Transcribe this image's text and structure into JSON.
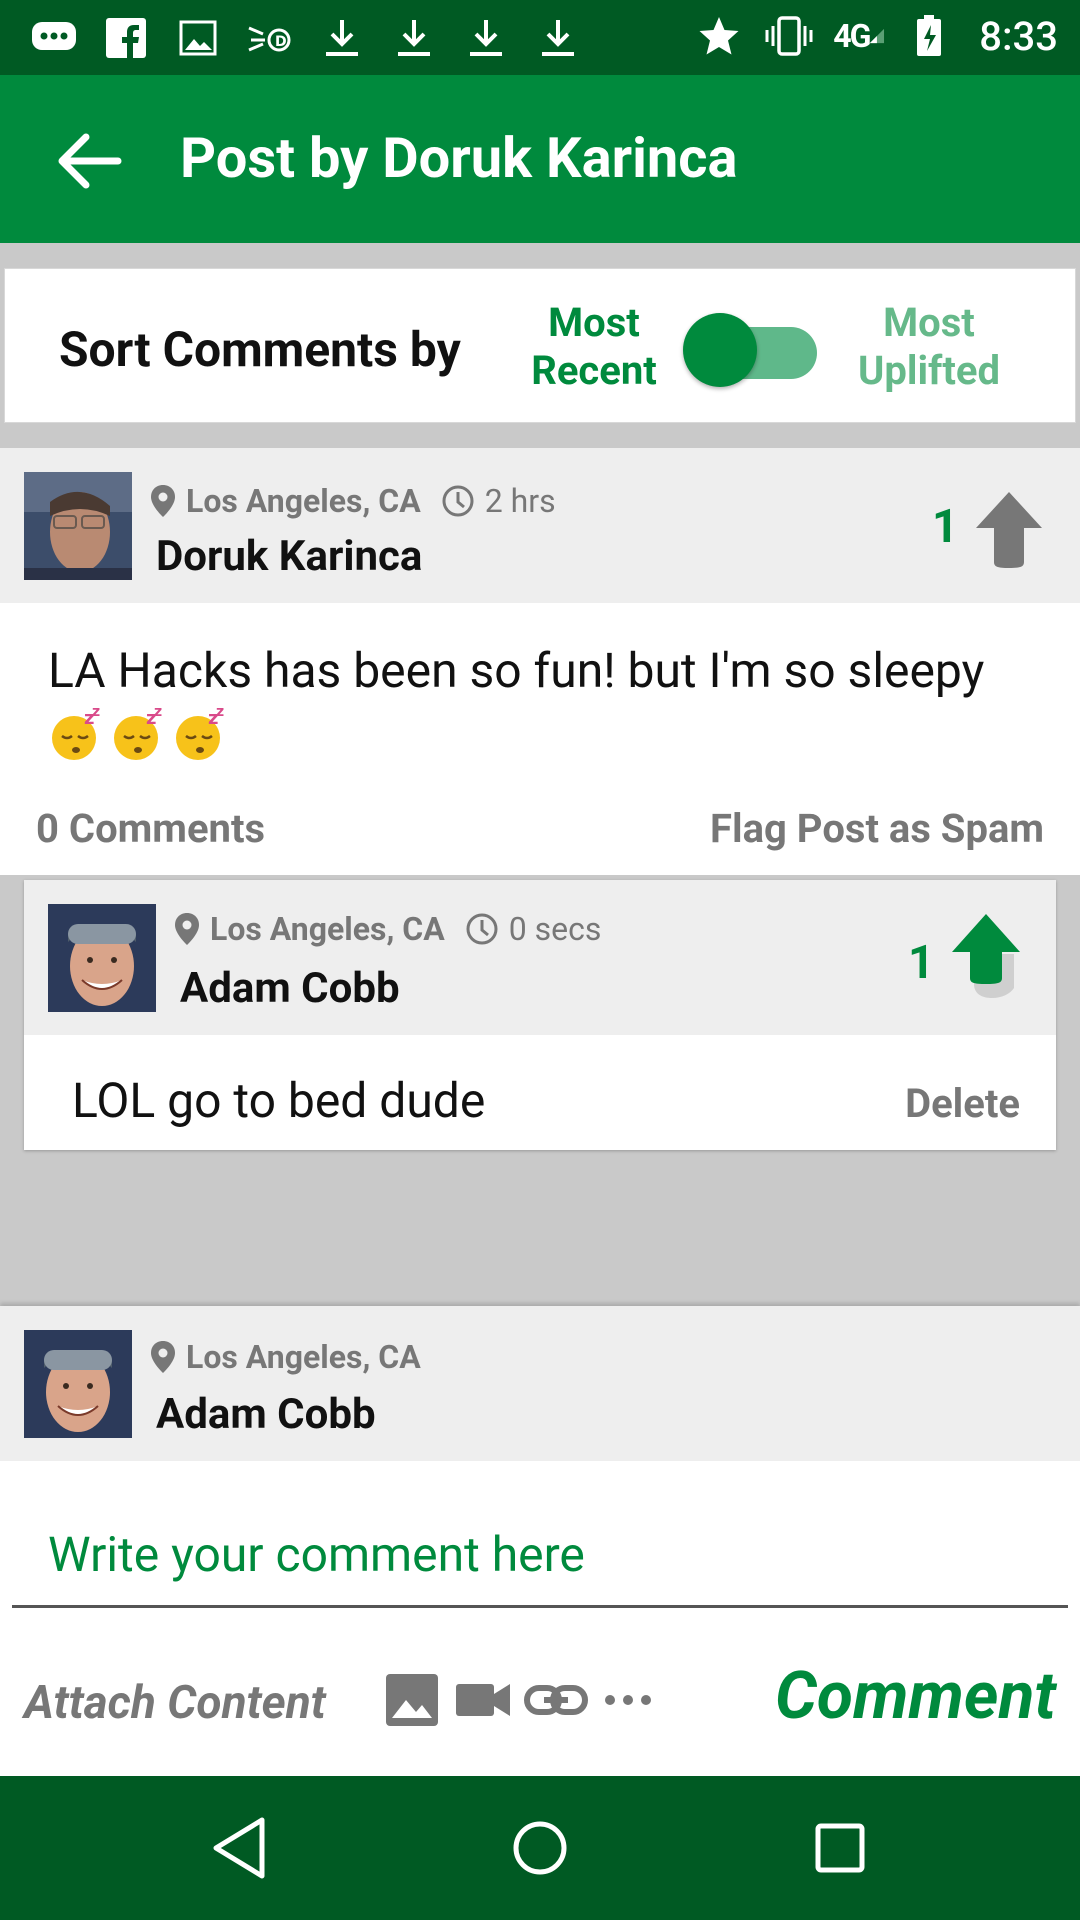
{
  "status_bar": {
    "time": "8:33",
    "network": "4G",
    "left_icons": [
      "messages-icon",
      "facebook-icon",
      "image-icon",
      "hand-icon",
      "download-icon",
      "download-icon",
      "download-icon",
      "download-icon"
    ],
    "right_icons": [
      "star-icon",
      "vibrate-icon",
      "signal-icon",
      "battery-charging-icon"
    ]
  },
  "app_bar": {
    "back_icon": "arrow-back-icon",
    "title": "Post by Doruk Karinca"
  },
  "sort": {
    "label": "Sort Comments by",
    "option_left": "Most Recent",
    "option_right": "Most Uplifted",
    "selected": "Most Recent"
  },
  "post": {
    "location": "Los Angeles, CA",
    "time_ago": "2 hrs",
    "author": "Doruk Karinca",
    "votes": "1",
    "text": "LA Hacks has been so fun! but I'm so sleepy",
    "emoji_count": 3,
    "comment_count_label": "0 Comments",
    "flag_label": "Flag Post as Spam"
  },
  "comment": {
    "location": "Los Angeles, CA",
    "time_ago": "0 secs",
    "author": "Adam Cobb",
    "votes": "1",
    "text": "LOL go to bed dude",
    "delete_label": "Delete",
    "upvoted": true
  },
  "composer": {
    "location": "Los Angeles, CA",
    "author": "Adam Cobb",
    "placeholder": "Write your comment here",
    "attach_label": "Attach Content",
    "attach_icons": [
      "image-icon",
      "video-camera-icon",
      "link-icon",
      "more-icon"
    ],
    "submit_label": "Comment"
  },
  "colors": {
    "status_bar": "#005a23",
    "app_bar": "#008a3d",
    "accent_green": "#008a3d",
    "light_green": "#66b98a",
    "gray_text": "#777777",
    "card_header": "#eeeeee"
  }
}
